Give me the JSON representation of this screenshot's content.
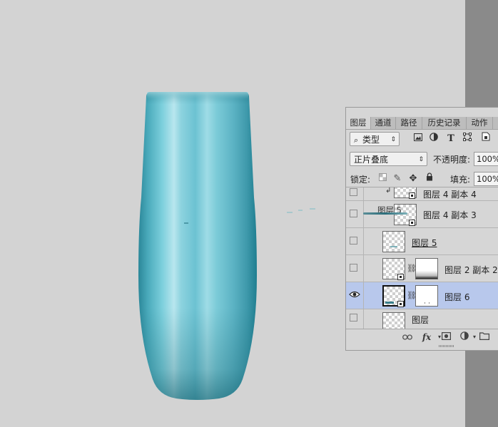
{
  "colors": {
    "canvas_bg": "#d3d3d3",
    "vase_light": "#b4e4ec",
    "vase_mid": "#6cc2d2",
    "vase_dark": "#1f7e90",
    "selection": "#b8c8ec"
  },
  "panel": {
    "tabs": [
      {
        "label": "图层",
        "active": true
      },
      {
        "label": "通道",
        "active": false
      },
      {
        "label": "路径",
        "active": false
      },
      {
        "label": "历史记录",
        "active": false
      },
      {
        "label": "动作",
        "active": false
      }
    ],
    "filter": {
      "search_icon": "search-icon",
      "value": "类型"
    },
    "filter_icons": [
      "image-filter-icon",
      "adjustment-filter-icon",
      "type-filter-icon",
      "shape-filter-icon",
      "smart-object-filter-icon"
    ],
    "blend_mode": "正片叠底",
    "opacity_label": "不透明度:",
    "opacity_value": "100%",
    "lock_label": "锁定:",
    "lock_icons": [
      "lock-transparent-icon",
      "lock-paint-icon",
      "lock-move-icon",
      "lock-all-icon"
    ],
    "fill_label": "填充:",
    "fill_value": "100%",
    "layers": [
      {
        "name": "图层 4 副本 4",
        "visible": false,
        "has_mask": false,
        "clipped": true,
        "selected": false
      },
      {
        "name": "图层 4 副本 3",
        "visible": false,
        "has_mask": false,
        "clipped": false,
        "selected": false
      },
      {
        "name": "图层 5",
        "visible": false,
        "has_mask": false,
        "clipped": false,
        "selected": false
      },
      {
        "name": "图层 2 副本 2",
        "visible": false,
        "has_mask": true,
        "clipped": false,
        "selected": false
      },
      {
        "name": "图层 6",
        "visible": true,
        "has_mask": true,
        "clipped": false,
        "selected": true
      },
      {
        "name": "图层",
        "visible": false,
        "has_mask": false,
        "clipped": false,
        "selected": false
      }
    ],
    "drag_ghost_label": "图层 5",
    "bottom_icons": [
      "link-layers-icon",
      "fx-icon",
      "add-mask-icon",
      "adjustment-layer-icon",
      "new-group-icon"
    ],
    "fx_label": "fx"
  }
}
